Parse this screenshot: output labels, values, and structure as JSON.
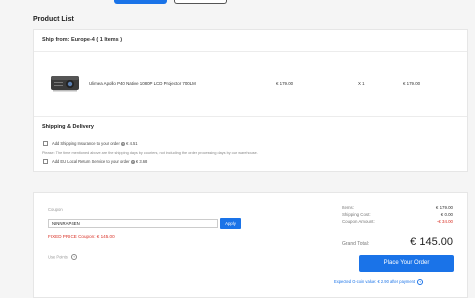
{
  "page": {
    "section_title": "Product List"
  },
  "shipment": {
    "ship_from": "Ship from: Europe-4 ( 1 Items )",
    "product": {
      "name": "Ulimea Apollo P40 Native 1080P LCD Projector 700LM",
      "unit_price": "€ 179.00",
      "quantity": "X 1",
      "total": "€ 179.00"
    }
  },
  "shipping": {
    "title": "Shipping & Delivery",
    "insurance_label": "Add Shipping Insurance to your order",
    "insurance_price": "€ 4.51",
    "note": "Please: The time mentioned above are the shipping days by couriers, not including the order processing days by our warehouse.",
    "return_label": "Add EU Local Return Service to your order",
    "return_price": "€ 3.68"
  },
  "coupon": {
    "label": "Coupon",
    "code": "NINNRAP4EN",
    "apply_label": "Apply",
    "fixed_price_text": "FIXED PRICE Coupon: € 145.00",
    "use_points_label": "Use Points"
  },
  "summary": {
    "items_label": "Items:",
    "items_value": "€ 179.00",
    "shipping_label": "Shipping Cost:",
    "shipping_value": "€ 0.00",
    "coupon_label": "Coupon Amount:",
    "coupon_value": "-€ 34.00",
    "grand_label": "Grand Total:",
    "grand_value": "€ 145.00",
    "place_order_label": "Place Your Order",
    "gcoin_text": "Expected G-coin value: € 2.90 after payment"
  },
  "colors": {
    "accent": "#1a73e8",
    "discount": "#d93025"
  }
}
